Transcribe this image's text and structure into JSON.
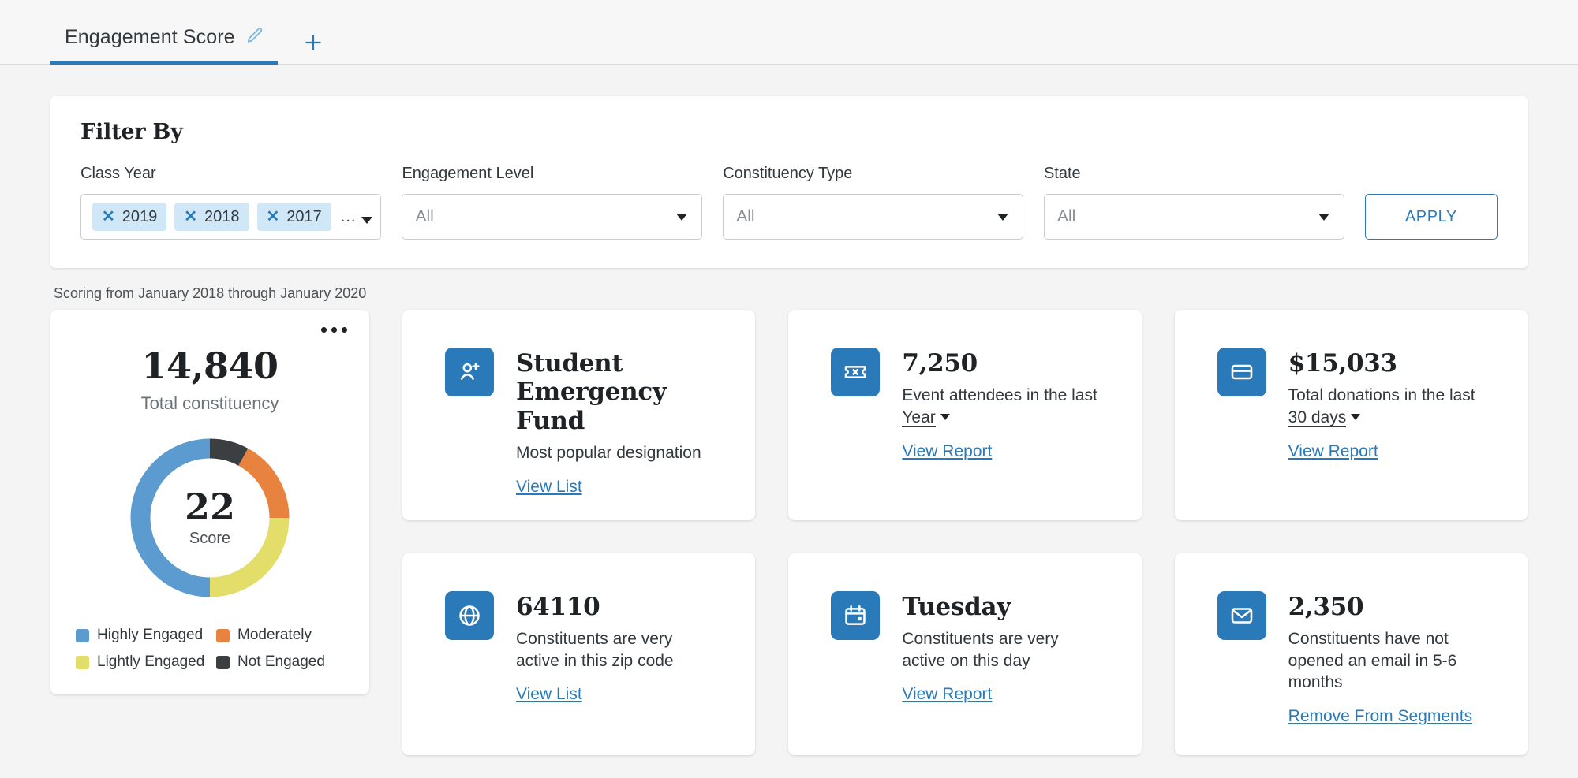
{
  "theme": {
    "accent": "#2a7ab9",
    "page_bg": "#f4f4f4",
    "card_bg": "#ffffff",
    "link": "#2a7ab9"
  },
  "tabbar": {
    "tab_label": "Engagement Score",
    "edit_icon": "pencil-icon",
    "add_icon": "plus-icon"
  },
  "filter": {
    "title": "Filter By",
    "apply_label": "APPLY",
    "class_year": {
      "label": "Class Year",
      "chips": [
        "2019",
        "2018",
        "2017"
      ],
      "overflow": "...",
      "remove_icon": "close-icon"
    },
    "engagement_level": {
      "label": "Engagement Level",
      "value": "All"
    },
    "constituency_type": {
      "label": "Constituency Type",
      "value": "All"
    },
    "state": {
      "label": "State",
      "value": "All"
    }
  },
  "scoring_note": "Scoring from January 2018 through January 2020",
  "donut_card": {
    "menu_icon": "kebab-menu-icon",
    "total_value": "14,840",
    "total_label": "Total constituency",
    "score_value": "22",
    "score_label": "Score"
  },
  "chart_data": {
    "type": "pie",
    "title": "Engagement Score",
    "subtitle": "Total constituency 14,840",
    "center_value": "22",
    "center_label": "Score",
    "legend_position": "bottom",
    "categories": [
      "Highly Engaged",
      "Moderately",
      "Lightly Engaged",
      "Not Engaged"
    ],
    "values": [
      50,
      17,
      25,
      8
    ],
    "unit": "percent",
    "colors": [
      "#5b9bd0",
      "#e8833f",
      "#e3dd6a",
      "#3b3f42"
    ],
    "start_angle_deg": 0,
    "direction": "clockwise",
    "segment_order_from_top_clockwise": [
      "Not Engaged",
      "Moderately",
      "Lightly Engaged",
      "Highly Engaged"
    ]
  },
  "cards": [
    {
      "icon": "user-add-icon",
      "headline": "Student Emergency Fund",
      "description": "Most popular designation",
      "link": "View List"
    },
    {
      "icon": "ticket-icon",
      "headline": "7,250",
      "description_before": "Event attendees in the last",
      "dropdown": "Year",
      "description_after": "",
      "link": "View Report"
    },
    {
      "icon": "credit-card-icon",
      "headline": "$15,033",
      "description_before": "Total donations in the last",
      "dropdown": "30 days",
      "description_after": "",
      "link": "View Report"
    },
    {
      "icon": "globe-icon",
      "headline": "64110",
      "description": "Constituents are very active in this zip code",
      "link": "View List"
    },
    {
      "icon": "calendar-icon",
      "headline": "Tuesday",
      "description": "Constituents are very active on this day",
      "link": "View Report"
    },
    {
      "icon": "envelope-icon",
      "headline": "2,350",
      "description": "Constituents have not opened an email in 5-6 months",
      "link": "Remove From Segments"
    }
  ]
}
